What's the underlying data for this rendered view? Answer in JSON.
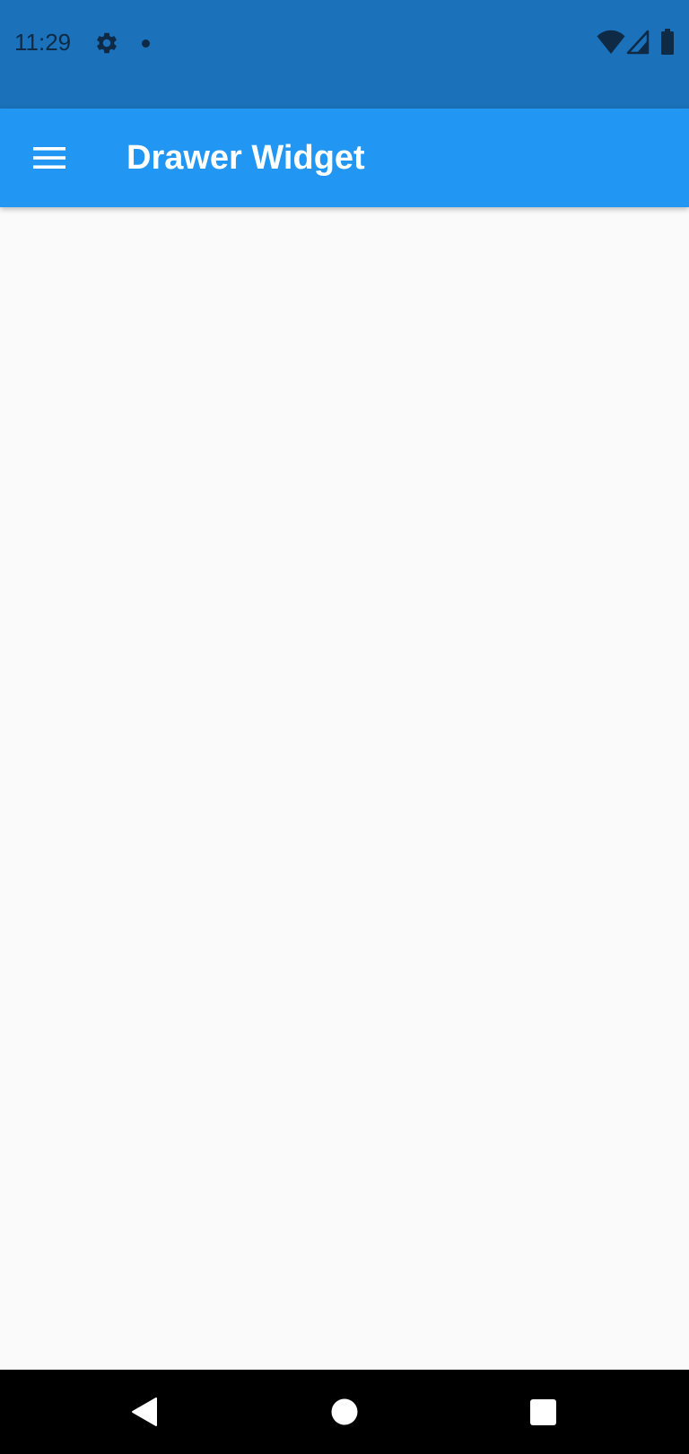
{
  "status_bar": {
    "time": "11:29",
    "background": "#1B72BB",
    "icons": [
      "settings-icon",
      "notification-dot-icon",
      "wifi-icon",
      "cell-signal-icon",
      "battery-icon"
    ]
  },
  "app_bar": {
    "title": "Drawer Widget",
    "background": "#2196F3",
    "menu_icon": "menu-icon"
  },
  "body": {
    "background": "#FAFAFA"
  },
  "nav_bar": {
    "background": "#000000",
    "buttons": [
      "back-icon",
      "home-icon",
      "recents-icon"
    ]
  }
}
